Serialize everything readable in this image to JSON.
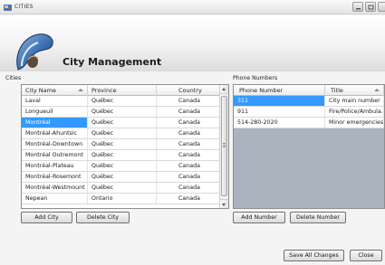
{
  "window": {
    "title": "CITIES"
  },
  "header": {
    "title": "City Management"
  },
  "cities": {
    "label": "Cities",
    "columns": [
      "City Name",
      "Province",
      "Country"
    ],
    "rows": [
      [
        "Laval",
        "Québec",
        "Canada"
      ],
      [
        "Longueuil",
        "Québec",
        "Canada"
      ],
      [
        "Montréal",
        "Québec",
        "Canada"
      ],
      [
        "Montréal-Ahuntsic",
        "Québec",
        "Canada"
      ],
      [
        "Montréal-Downtown",
        "Québec",
        "Canada"
      ],
      [
        "Montréal Outremont",
        "Québec",
        "Canada"
      ],
      [
        "Montréal-Plateau",
        "Québec",
        "Canada"
      ],
      [
        "Montréal-Rosemont",
        "Québec",
        "Canada"
      ],
      [
        "Montréal-Westmount",
        "Québec",
        "Canada"
      ],
      [
        "Nepean",
        "Ontario",
        "Canada"
      ]
    ],
    "selected_index": 2
  },
  "phones": {
    "label": "Phone Numbers",
    "columns": [
      "Phone Number",
      "Title"
    ],
    "rows": [
      [
        "311",
        "City main number"
      ],
      [
        "911",
        "Fire/Police/Ambula..."
      ],
      [
        "514-280-2020",
        "Minor emergencies"
      ]
    ],
    "selected_index": 0
  },
  "buttons": {
    "add_city": "Add City",
    "delete_city": "Delete City",
    "add_number": "Add Number",
    "delete_number": "Delete Number",
    "save_all": "Save All Changes",
    "close": "Close"
  }
}
